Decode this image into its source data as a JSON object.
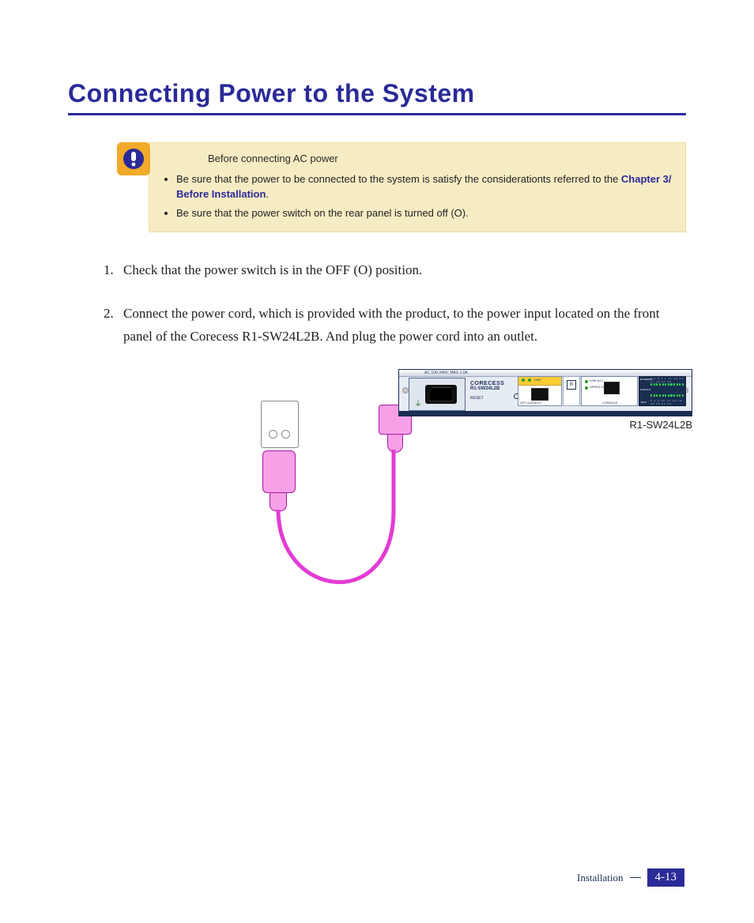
{
  "title": "Connecting Power to the System",
  "callout": {
    "heading": "Before connecting AC power",
    "bullet1_pre": "Be sure that the power to be connected to the system is satisfy the considerationts referred to the ",
    "bullet1_link": "Chapter 3/ Before Installation",
    "bullet1_post": ".",
    "bullet2": "Be sure that the power switch on the rear panel is turned off (O)."
  },
  "steps": {
    "s1": "Check that the power switch is in the OFF (O) position.",
    "s2": "Connect the power cord, which is provided with the product, to the power input located on the front panel of the Corecess R1-SW24L2B. And plug the power cord into an outlet."
  },
  "device": {
    "ac_label": "AC 100-240V, MAX 1.0A",
    "brand": "CORECESS",
    "model": "R1-SW24L2B",
    "reset": "RESET",
    "module1_link": "LINK",
    "module1_act": "ACT",
    "module1_opt": "OPT-61E51CO",
    "slot_letter": "B",
    "module3_link": "LINK   ACT",
    "module3_speed": "SPEED  1000",
    "module3_console": "CONSOLE",
    "led_eth": "ETHERNET",
    "led_linkact": "LINK/ACT",
    "led_run": "RUN",
    "led_numtop": "1 3 5 7 1 11 13 15 17 19 21 23",
    "led_numbot": "2 4 6 10 12 14 16 18 20 22 24",
    "caption": "R1-SW24L2B"
  },
  "footer": {
    "section": "Installation",
    "page": "4-13"
  }
}
